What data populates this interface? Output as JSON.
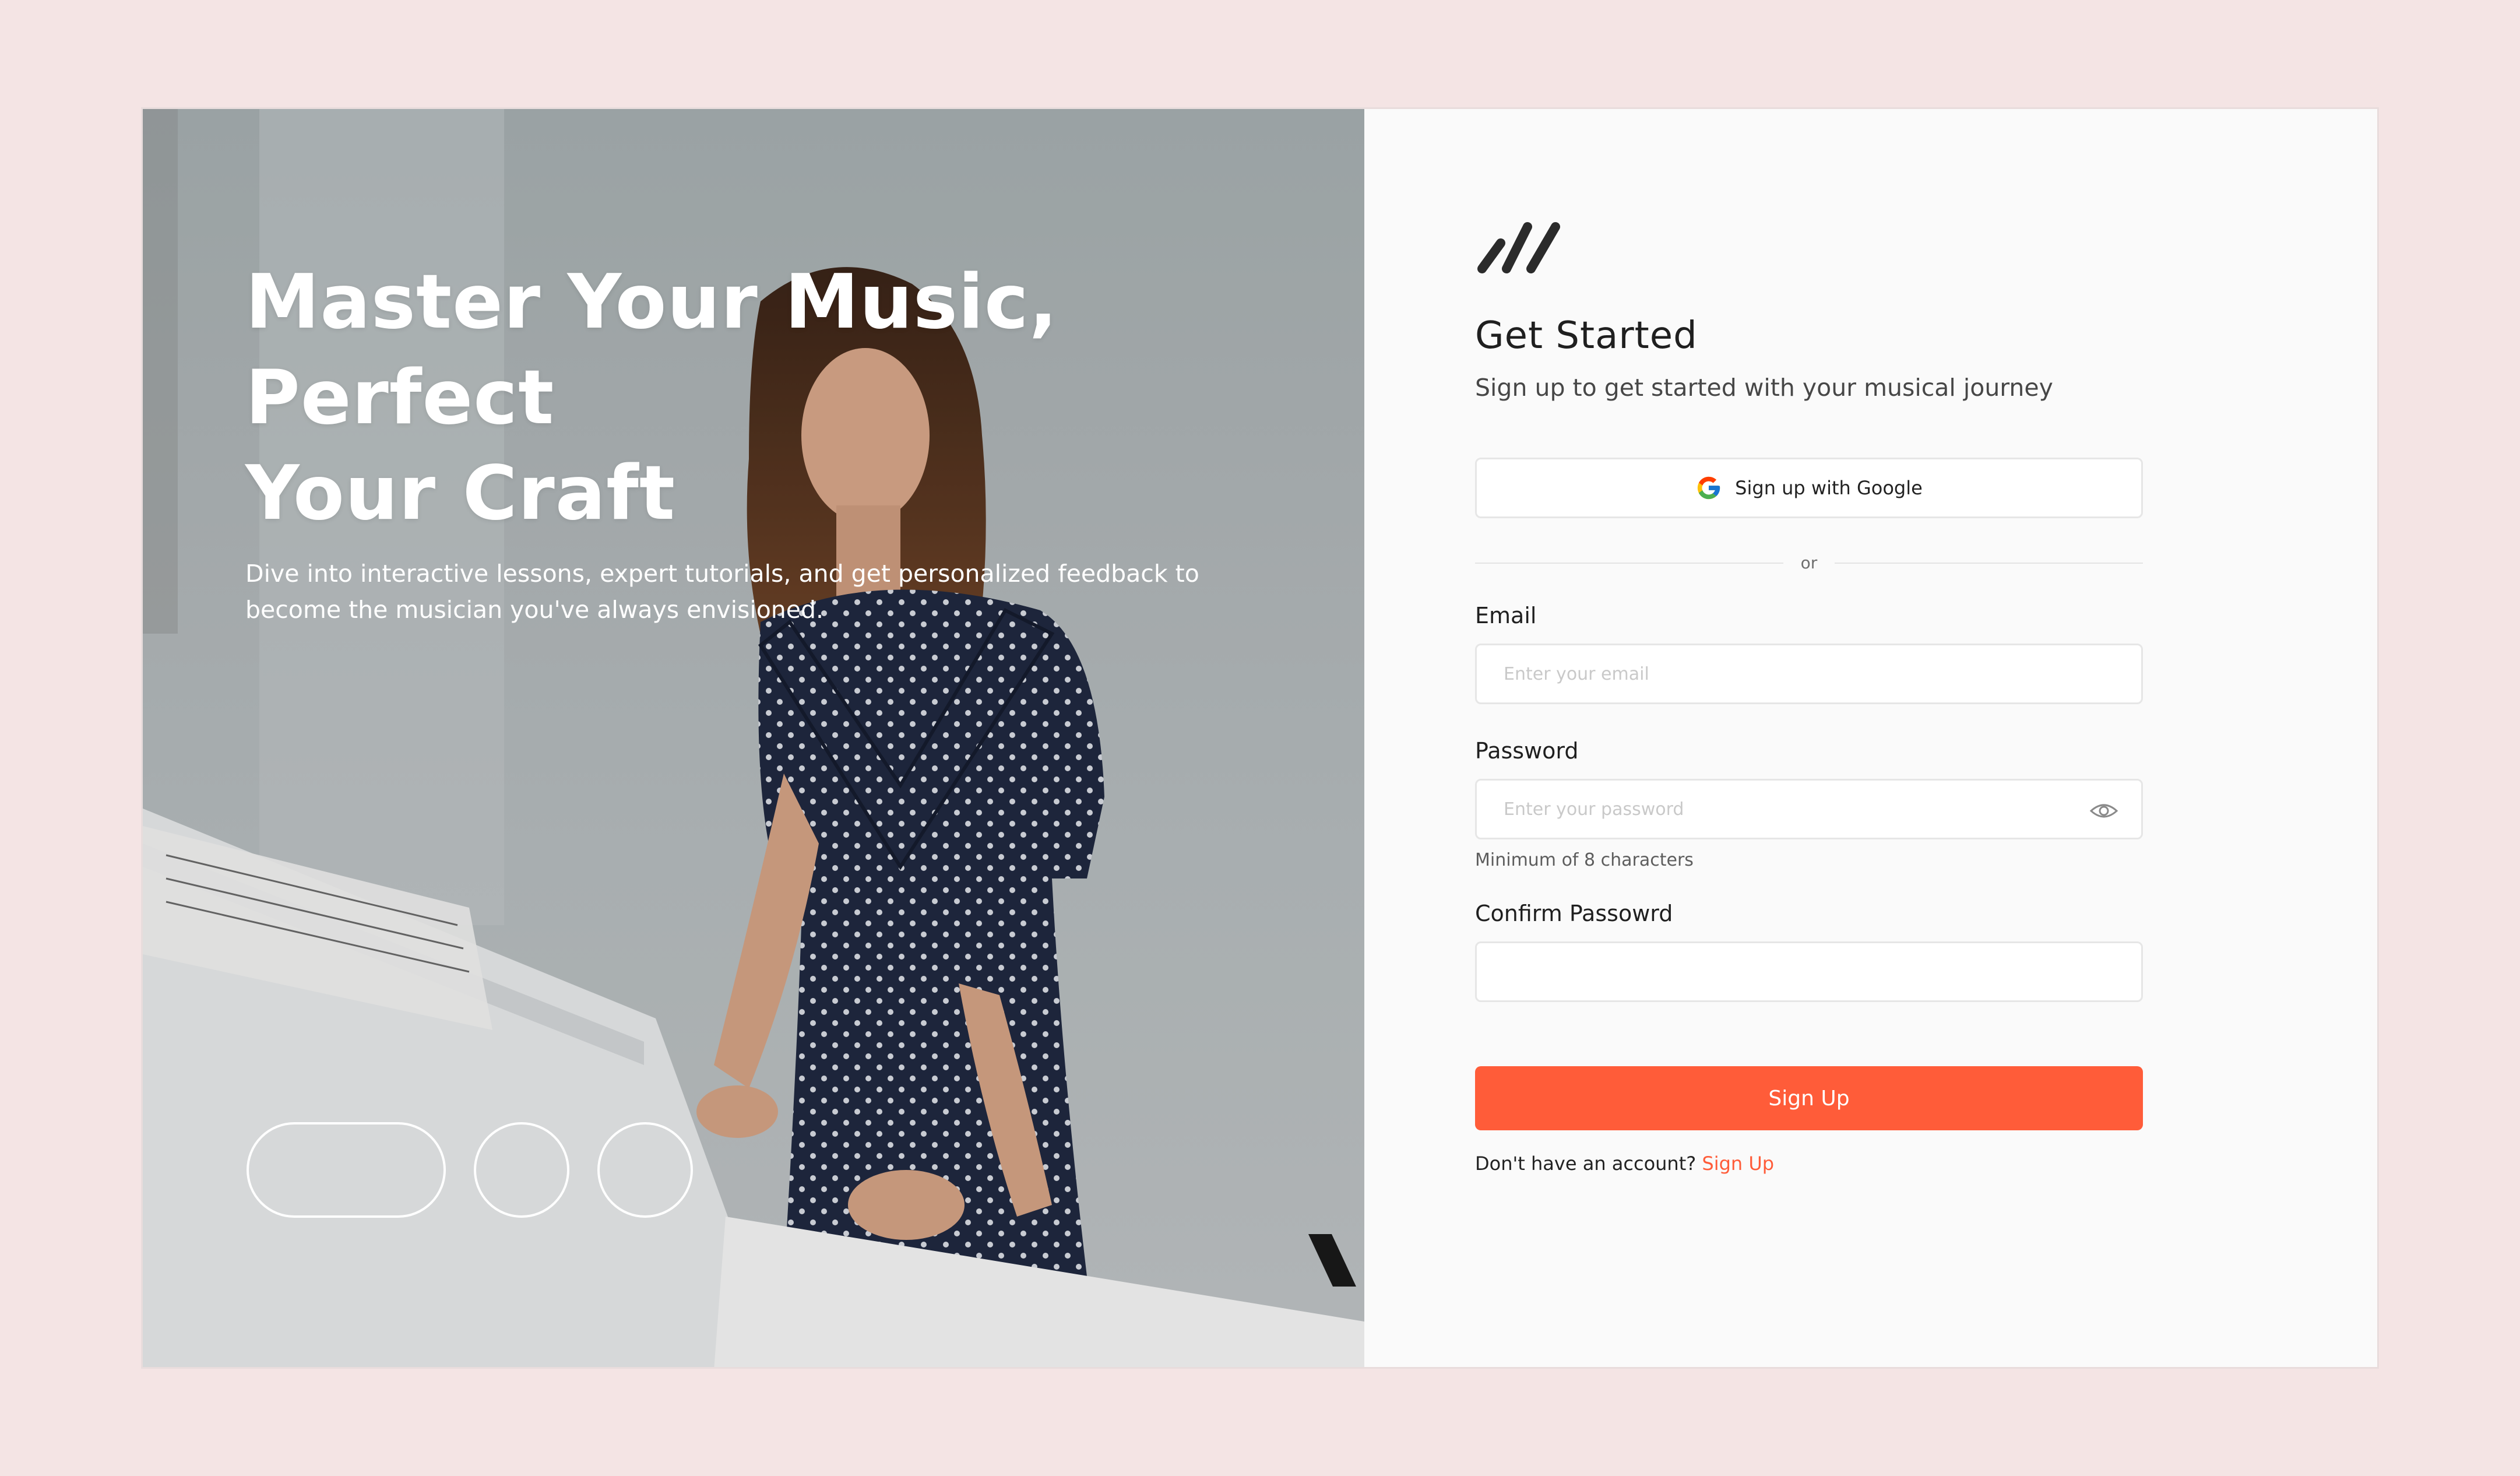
{
  "hero": {
    "title_line1": "Master Your Music, Perfect",
    "title_line2": "Your Craft",
    "subtitle_line1": "Dive into interactive lessons, expert tutorials, and get personalized feedback to",
    "subtitle_line2": "become the musician you've always envisioned.",
    "carousel_count": 3,
    "carousel_active": 0
  },
  "form": {
    "logo_icon": "triple-slash-logo",
    "title": "Get Started",
    "subtitle": "Sign up to get started with your musical journey",
    "google_button": "Sign up with Google",
    "divider_text": "or",
    "email": {
      "label": "Email",
      "placeholder": "Enter your email",
      "value": ""
    },
    "password": {
      "label": "Password",
      "placeholder": "Enter your password",
      "value": "",
      "hint": "Minimum of 8 characters",
      "toggle_icon": "eye-icon"
    },
    "confirm": {
      "label": "Confirm Passowrd",
      "placeholder": "",
      "value": ""
    },
    "submit": "Sign Up",
    "footer_text": "Don't have an account?",
    "footer_link": "Sign Up"
  },
  "colors": {
    "accent": "#ff5c39",
    "page_bg": "#f4e4e4",
    "panel_bg": "#fafafa"
  }
}
